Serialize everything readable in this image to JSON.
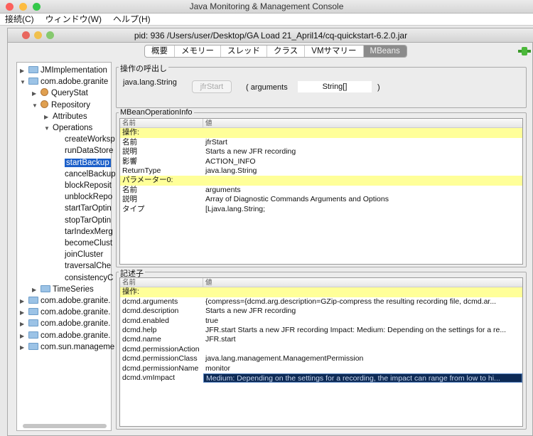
{
  "app": {
    "title": "Java Monitoring & Management Console"
  },
  "menu": [
    "接続(C)",
    "ウィンドウ(W)",
    "ヘルプ(H)"
  ],
  "window": {
    "title": "pid: 936 /Users/user/Desktop/GA Load 21_April14/cq-quickstart-6.2.0.jar"
  },
  "tabs": [
    {
      "label": "概要"
    },
    {
      "label": "メモリー"
    },
    {
      "label": "スレッド"
    },
    {
      "label": "クラス"
    },
    {
      "label": "VMサマリー"
    },
    {
      "label": "MBeans",
      "selected": true
    }
  ],
  "tree": [
    {
      "label": "JMImplementation",
      "level": 0,
      "type": "folder",
      "state": "collapsed"
    },
    {
      "label": "com.adobe.granite",
      "level": 0,
      "type": "folder",
      "state": "expanded"
    },
    {
      "label": "QueryStat",
      "level": 1,
      "type": "bean",
      "state": "collapsed"
    },
    {
      "label": "Repository",
      "level": 1,
      "type": "bean",
      "state": "expanded"
    },
    {
      "label": "Attributes",
      "level": 2,
      "type": "text",
      "state": "collapsed"
    },
    {
      "label": "Operations",
      "level": 2,
      "type": "text",
      "state": "expanded"
    },
    {
      "label": "createWorksp",
      "level": 3,
      "type": "leaf"
    },
    {
      "label": "runDataStore",
      "level": 3,
      "type": "leaf"
    },
    {
      "label": "startBackup",
      "level": 3,
      "type": "leaf",
      "selected": true
    },
    {
      "label": "cancelBackup",
      "level": 3,
      "type": "leaf"
    },
    {
      "label": "blockReposit",
      "level": 3,
      "type": "leaf"
    },
    {
      "label": "unblockRepo",
      "level": 3,
      "type": "leaf"
    },
    {
      "label": "startTarOptin",
      "level": 3,
      "type": "leaf"
    },
    {
      "label": "stopTarOptin",
      "level": 3,
      "type": "leaf"
    },
    {
      "label": "tarIndexMerg",
      "level": 3,
      "type": "leaf"
    },
    {
      "label": "becomeClust",
      "level": 3,
      "type": "leaf"
    },
    {
      "label": "joinCluster",
      "level": 3,
      "type": "leaf"
    },
    {
      "label": "traversalChe",
      "level": 3,
      "type": "leaf"
    },
    {
      "label": "consistencyC",
      "level": 3,
      "type": "leaf"
    },
    {
      "label": "TimeSeries",
      "level": 1,
      "type": "folder",
      "state": "collapsed"
    },
    {
      "label": "com.adobe.granite.",
      "level": 0,
      "type": "folder",
      "state": "collapsed"
    },
    {
      "label": "com.adobe.granite.",
      "level": 0,
      "type": "folder",
      "state": "collapsed"
    },
    {
      "label": "com.adobe.granite.",
      "level": 0,
      "type": "folder",
      "state": "collapsed"
    },
    {
      "label": "com.adobe.granite.",
      "level": 0,
      "type": "folder",
      "state": "collapsed"
    },
    {
      "label": "com.sun.manageme",
      "level": 0,
      "type": "folder",
      "state": "collapsed"
    }
  ],
  "invoke": {
    "title": "操作の呼出し",
    "return_type": "java.lang.String",
    "button": "jfrStart",
    "open": "( arguments",
    "arg_value": "String[]",
    "close": ")"
  },
  "opinfo": {
    "title": "MBeanOperationInfo",
    "headers": [
      "名前",
      "値"
    ],
    "rows": [
      {
        "k": "操作:",
        "v": "",
        "yellow": true
      },
      {
        "k": "名前",
        "v": "jfrStart"
      },
      {
        "k": "説明",
        "v": "Starts a new JFR recording"
      },
      {
        "k": "影響",
        "v": "ACTION_INFO"
      },
      {
        "k": "ReturnType",
        "v": "java.lang.String"
      },
      {
        "k": "パラメーター0:",
        "v": "",
        "yellow": true
      },
      {
        "k": "名前",
        "v": "arguments"
      },
      {
        "k": "説明",
        "v": "Array of Diagnostic Commands Arguments and Options"
      },
      {
        "k": "タイプ",
        "v": "[Ljava.lang.String;"
      }
    ]
  },
  "descriptor": {
    "title": "記述子",
    "headers": [
      "名前",
      "値"
    ],
    "rows": [
      {
        "k": "操作:",
        "v": "",
        "yellow": true
      },
      {
        "k": "dcmd.arguments",
        "v": "{compress={dcmd.arg.description=GZip-compress the resulting recording file, dcmd.ar..."
      },
      {
        "k": "dcmd.description",
        "v": "Starts a new JFR recording"
      },
      {
        "k": "dcmd.enabled",
        "v": "true"
      },
      {
        "k": "dcmd.help",
        "v": "JFR.start Starts a new JFR recording  Impact: Medium: Depending on the settings for a re..."
      },
      {
        "k": "dcmd.name",
        "v": "JFR.start"
      },
      {
        "k": "dcmd.permissionAction",
        "v": ""
      },
      {
        "k": "dcmd.permissionClass",
        "v": "java.lang.management.ManagementPermission"
      },
      {
        "k": "dcmd.permissionName",
        "v": "monitor"
      },
      {
        "k": "dcmd.vmImpact",
        "v": "Medium: Depending on the settings for a recording, the impact can range from low to hi...",
        "selected": true
      }
    ]
  }
}
